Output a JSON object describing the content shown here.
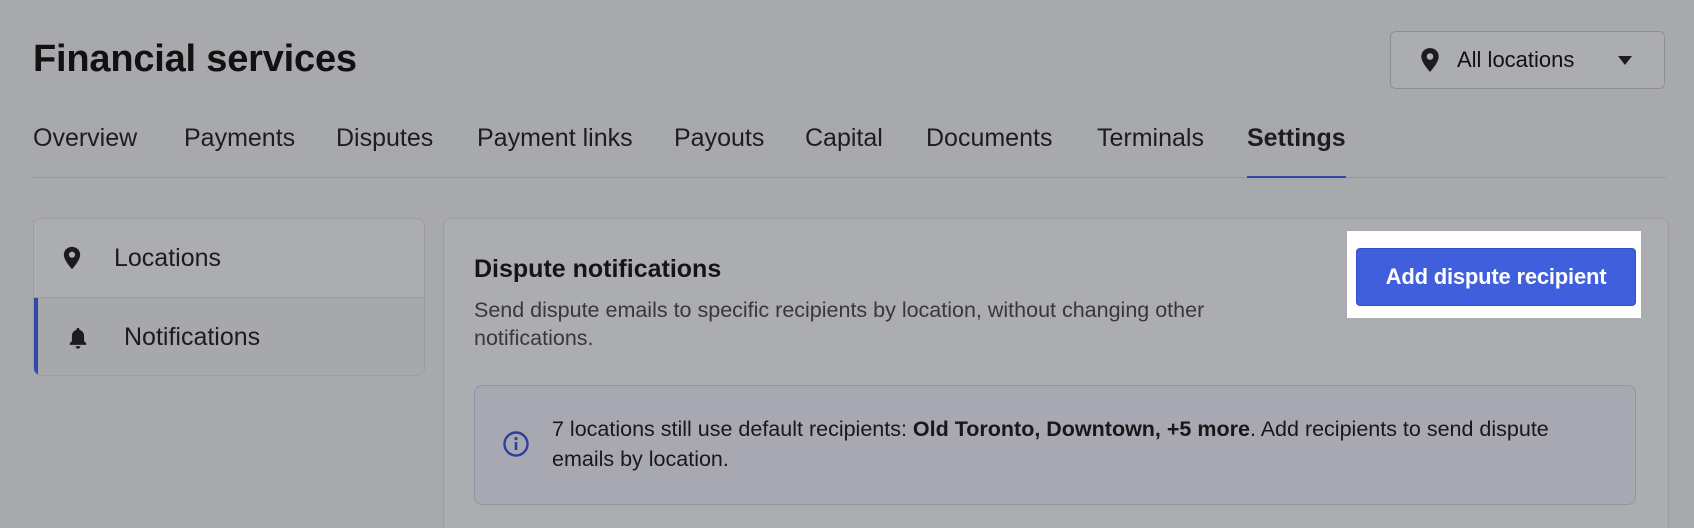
{
  "page": {
    "title": "Financial services"
  },
  "location_select": {
    "label": "All locations",
    "icon": "map-pin-icon"
  },
  "tabs": [
    {
      "label": "Overview"
    },
    {
      "label": "Payments"
    },
    {
      "label": "Disputes"
    },
    {
      "label": "Payment links"
    },
    {
      "label": "Payouts"
    },
    {
      "label": "Capital"
    },
    {
      "label": "Documents"
    },
    {
      "label": "Terminals"
    },
    {
      "label": "Settings",
      "active": true
    }
  ],
  "sidebar": {
    "items": [
      {
        "label": "Locations",
        "icon": "map-pin-icon"
      },
      {
        "label": "Notifications",
        "icon": "bell-icon",
        "active": true
      }
    ]
  },
  "panel": {
    "title": "Dispute notifications",
    "description": "Send dispute emails to specific recipients by location, without changing other notifications.",
    "add_button": "Add dispute recipient",
    "info": {
      "prefix": "7 locations still use default recipients: ",
      "bold": "Old Toronto, Downtown, +5 more",
      "suffix": ". Add recipients to send dispute emails by location."
    }
  },
  "colors": {
    "accent": "#3f5fdc",
    "tab_underline": "#3347a8",
    "overlay_bg": "#a8a9ac"
  }
}
